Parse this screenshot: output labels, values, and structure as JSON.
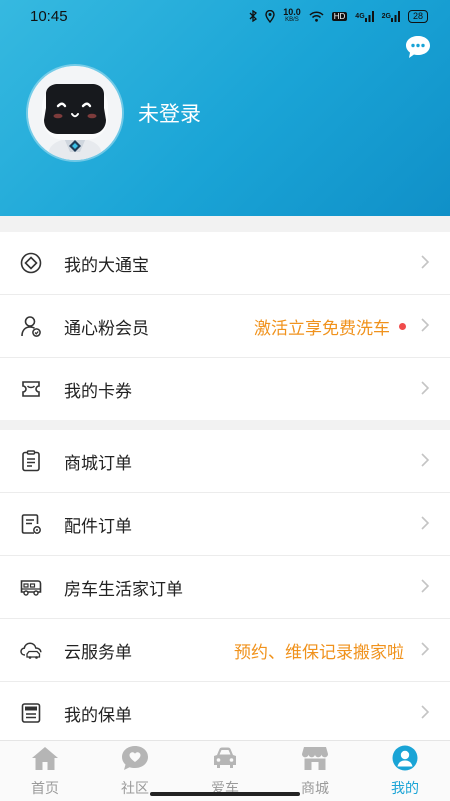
{
  "status": {
    "time": "10:45",
    "speed_value": "10.0",
    "speed_unit": "KB/S",
    "hd": "HD",
    "sig1": "4G",
    "sig2": "2G",
    "battery": "28"
  },
  "profile": {
    "login_text": "未登录"
  },
  "group1": [
    {
      "label": "我的大通宝",
      "icon": "coin-icon"
    },
    {
      "label": "通心粉会员",
      "extra": "激活立享免费洗车",
      "icon": "member-icon"
    },
    {
      "label": "我的卡券",
      "icon": "coupon-icon"
    }
  ],
  "group2": [
    {
      "label": "商城订单",
      "icon": "order-list-icon"
    },
    {
      "label": "配件订单",
      "icon": "parts-order-icon"
    },
    {
      "label": "房车生活家订单",
      "icon": "rv-icon"
    },
    {
      "label": "云服务单",
      "extra": "预约、维保记录搬家啦",
      "icon": "cloud-car-icon"
    },
    {
      "label": "我的保单",
      "icon": "policy-icon"
    }
  ],
  "nav": [
    {
      "label": "首页",
      "icon": "home-icon"
    },
    {
      "label": "社区",
      "icon": "community-icon"
    },
    {
      "label": "爱车",
      "icon": "car-icon"
    },
    {
      "label": "商城",
      "icon": "store-icon"
    },
    {
      "label": "我的",
      "icon": "profile-icon",
      "active": true
    }
  ],
  "colors": {
    "accent": "#1aa4d6",
    "promo": "#f0921c",
    "dot": "#f04b4b"
  }
}
